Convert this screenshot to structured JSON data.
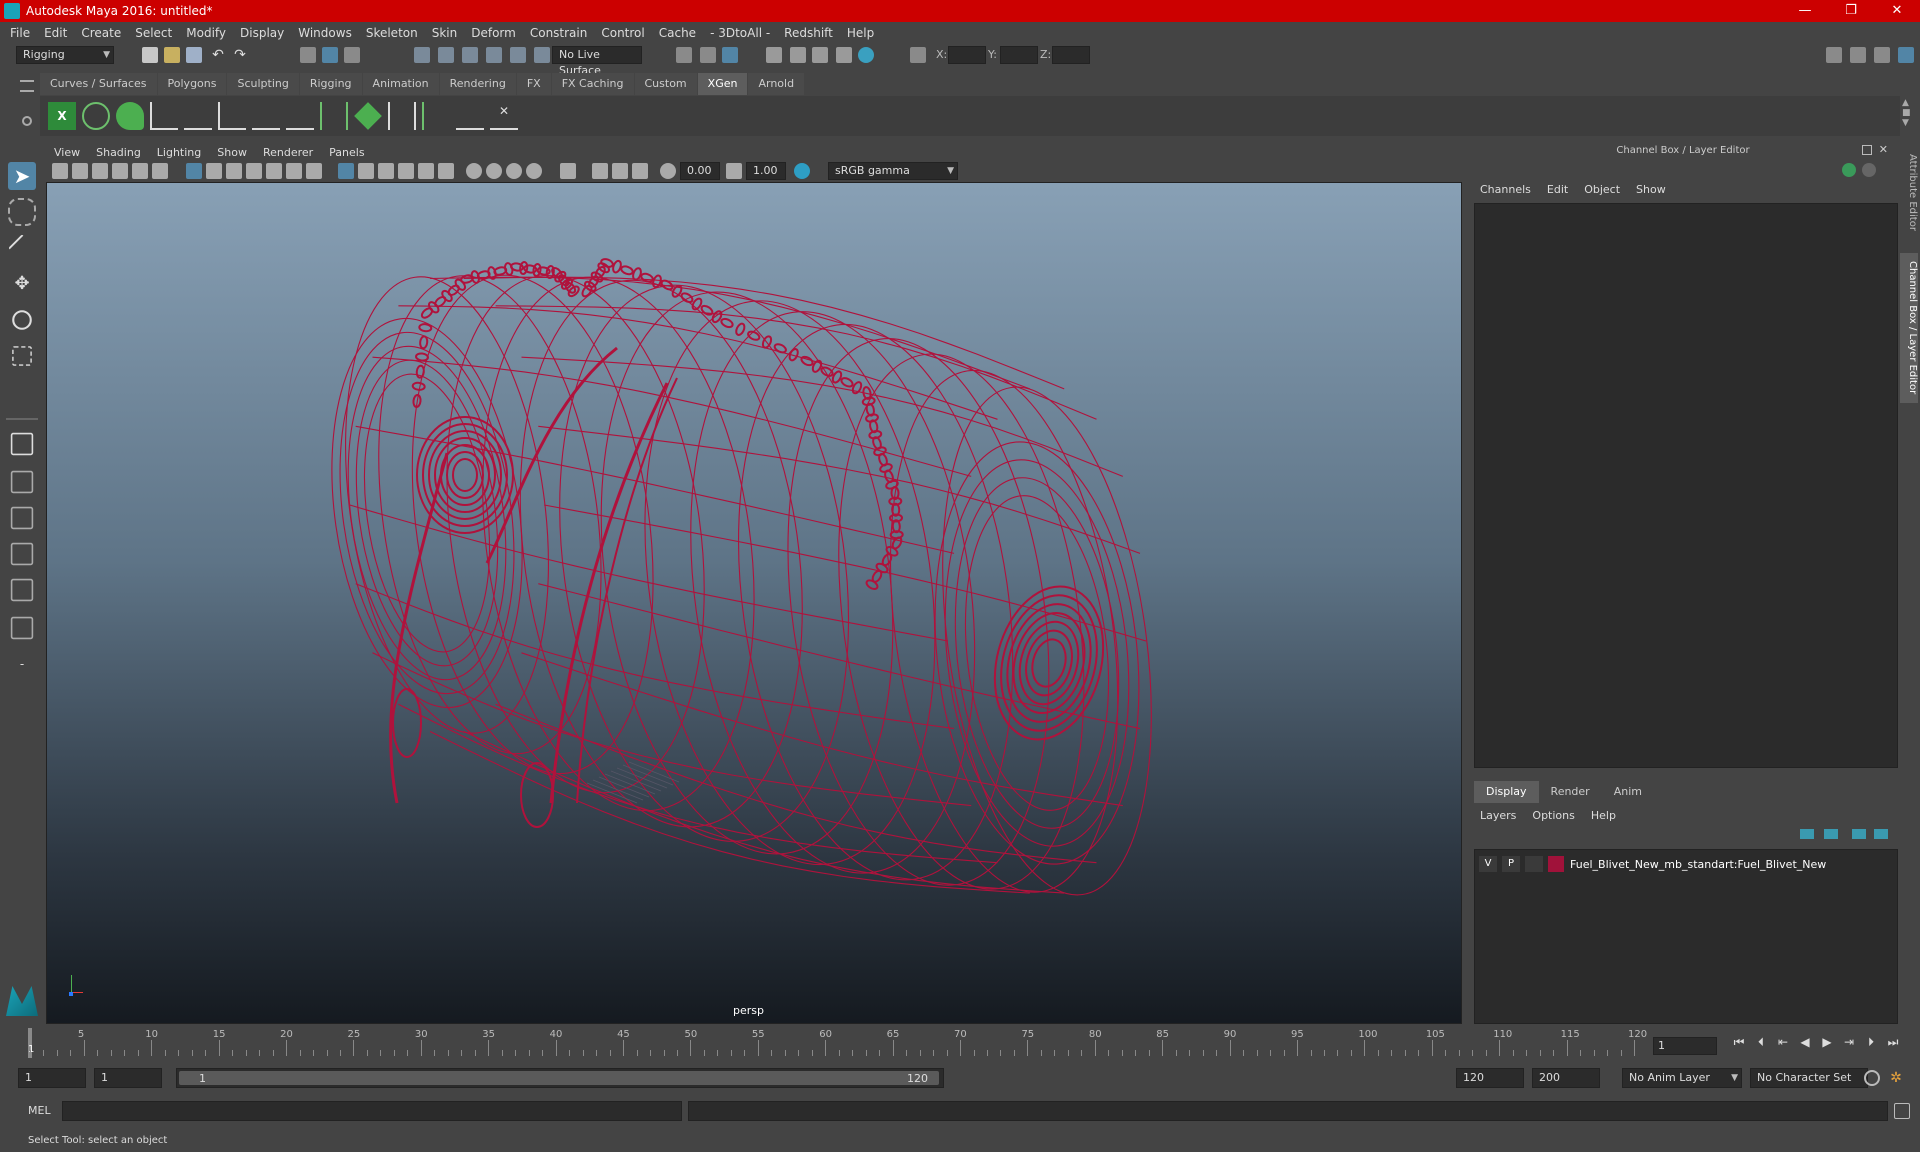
{
  "window": {
    "title": "Autodesk Maya 2016: untitled*",
    "controls": [
      "—",
      "❐",
      "✕"
    ]
  },
  "menu": [
    "File",
    "Edit",
    "Create",
    "Select",
    "Modify",
    "Display",
    "Windows",
    "Skeleton",
    "Skin",
    "Deform",
    "Constrain",
    "Control",
    "Cache",
    "- 3DtoAll -",
    "Redshift",
    "Help"
  ],
  "statusline": {
    "menu_set": "Rigging",
    "live_surface": "No Live Surface",
    "coord_labels": [
      "X:",
      "Y:",
      "Z:"
    ]
  },
  "shelf": {
    "tabs": [
      {
        "label": "Curves / Surfaces",
        "active": false
      },
      {
        "label": "Polygons",
        "active": false
      },
      {
        "label": "Sculpting",
        "active": false
      },
      {
        "label": "Rigging",
        "active": false
      },
      {
        "label": "Animation",
        "active": false
      },
      {
        "label": "Rendering",
        "active": false
      },
      {
        "label": "FX",
        "active": false
      },
      {
        "label": "FX Caching",
        "active": false
      },
      {
        "label": "Custom",
        "active": false
      },
      {
        "label": "XGen",
        "active": true
      },
      {
        "label": "Arnold",
        "active": false
      }
    ]
  },
  "viewport": {
    "menu": [
      "View",
      "Shading",
      "Lighting",
      "Show",
      "Renderer",
      "Panels"
    ],
    "exposure": "0.00",
    "gamma": "1.00",
    "color_space": "sRGB gamma",
    "camera": "persp",
    "wire_color": "#b0123c"
  },
  "channel_box": {
    "title": "Channel Box / Layer Editor",
    "menu": [
      "Channels",
      "Edit",
      "Object",
      "Show"
    ],
    "layer_tabs": [
      {
        "label": "Display",
        "active": true
      },
      {
        "label": "Render",
        "active": false
      },
      {
        "label": "Anim",
        "active": false
      }
    ],
    "layer_menu": [
      "Layers",
      "Options",
      "Help"
    ],
    "layer": {
      "visible": "V",
      "playback": "P",
      "name": "Fuel_Blivet_New_mb_standart:Fuel_Blivet_New",
      "color": "#a0123a"
    }
  },
  "side_tabs": [
    "Attribute Editor",
    "Channel Box / Layer Editor"
  ],
  "timeline": {
    "start": 1,
    "end": 120,
    "ticks": [
      "5",
      "10",
      "15",
      "20",
      "25",
      "30",
      "35",
      "40",
      "45",
      "50",
      "55",
      "60",
      "65",
      "70",
      "75",
      "80",
      "85",
      "90",
      "95",
      "100",
      "105",
      "110",
      "115",
      "120"
    ],
    "start_label": "1",
    "current_frame": "1"
  },
  "range": {
    "start_time": "1",
    "playback_start": "1",
    "slider_start": "1",
    "slider_end": "120",
    "playback_end": "120",
    "end_time": "200",
    "anim_layer": "No Anim Layer",
    "character_set": "No Character Set"
  },
  "command": {
    "language": "MEL"
  },
  "help_line": "Select Tool: select an object"
}
